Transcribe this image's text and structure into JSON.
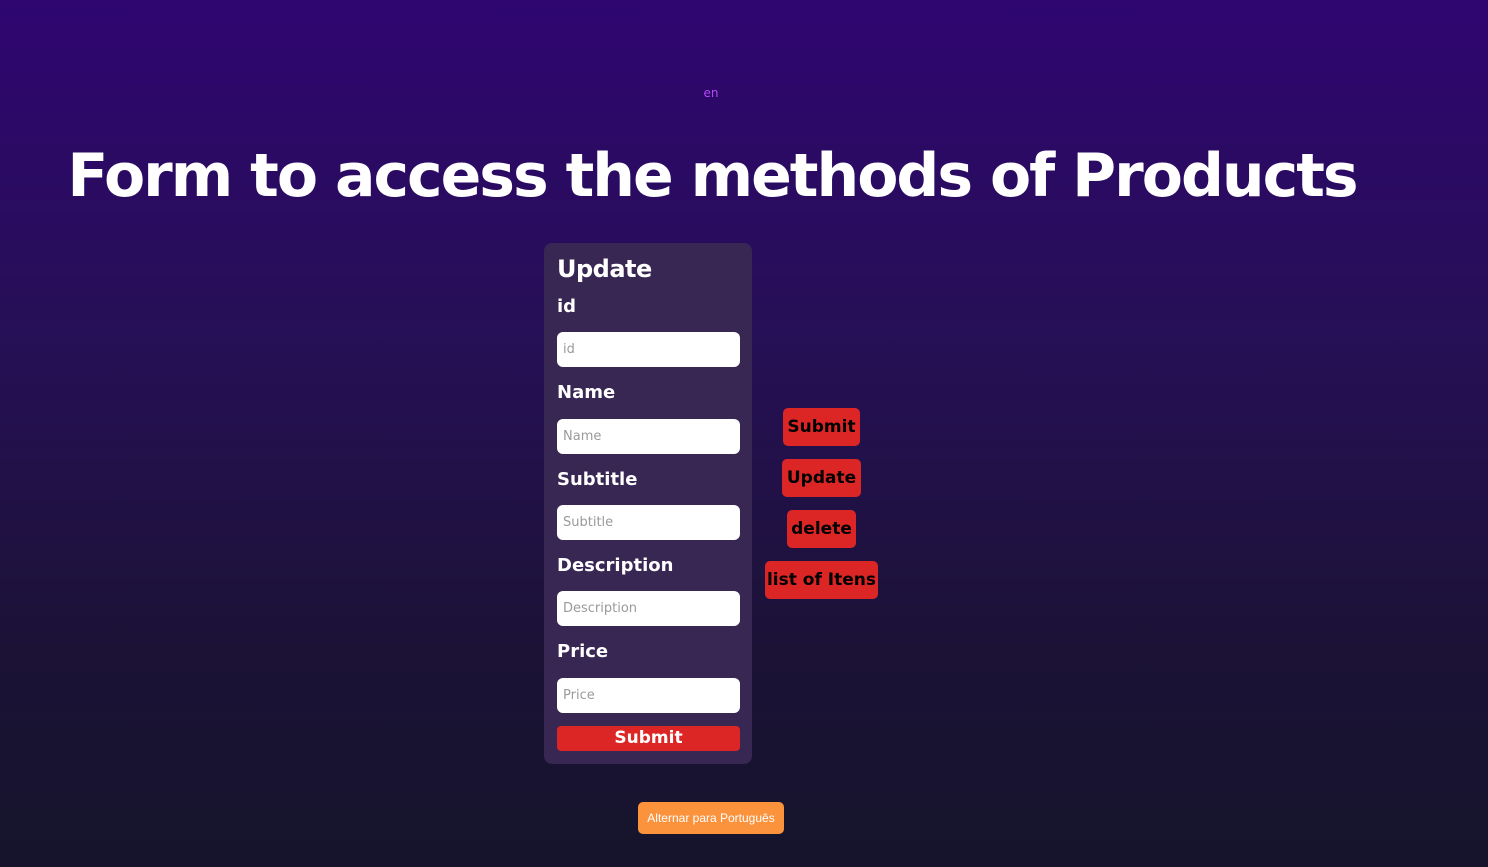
{
  "language": {
    "current_code": "en",
    "toggle_label": "Alternar para Português"
  },
  "page": {
    "title": "Form to access the methods of Products"
  },
  "form": {
    "heading": "Update",
    "fields": [
      {
        "label": "id",
        "placeholder": "id",
        "value": ""
      },
      {
        "label": "Name",
        "placeholder": "Name",
        "value": ""
      },
      {
        "label": "Subtitle",
        "placeholder": "Subtitle",
        "value": ""
      },
      {
        "label": "Description",
        "placeholder": "Description",
        "value": ""
      },
      {
        "label": "Price",
        "placeholder": "Price",
        "value": ""
      }
    ],
    "submit_label": "Submit"
  },
  "actions": {
    "submit_label": "Submit",
    "update_label": "Update",
    "delete_label": "delete",
    "list_label": "list of Itens"
  },
  "colors": {
    "background_top": "#2f0570",
    "background_bottom": "#16142c",
    "card": "#382653",
    "button_red": "#dc2626",
    "toggle_orange": "#fb923c",
    "lang_code": "#b14cf5"
  }
}
